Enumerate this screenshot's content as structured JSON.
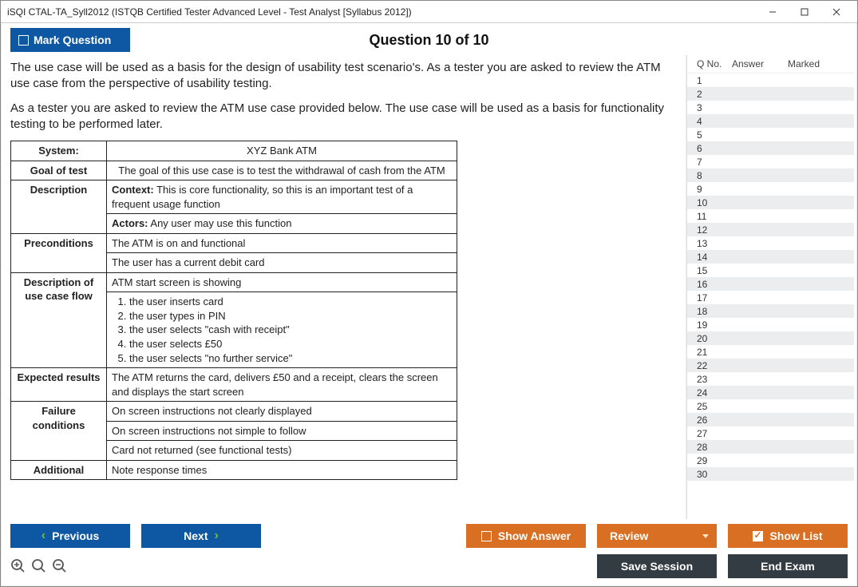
{
  "window": {
    "title": "iSQI CTAL-TA_Syll2012 (ISTQB Certified Tester Advanced Level - Test Analyst [Syllabus 2012])"
  },
  "header": {
    "mark_label": "Mark Question",
    "question_title": "Question 10 of 10"
  },
  "question": {
    "para1": "The use case will be used as a basis for the design of usability test scenario's. As a tester you are asked to review the ATM use case from the perspective of usability testing.",
    "para2": "As a tester you are asked to review the ATM use case provided below. The use case will be used as a basis for functionality testing to be performed later.",
    "table": {
      "system_lbl": "System:",
      "system_val": "XYZ Bank ATM",
      "goal_lbl": "Goal of test",
      "goal_val": "The goal of this use case is to test the withdrawal of cash from the ATM",
      "desc_lbl": "Description",
      "desc_ctx": "Context: This is core functionality, so this is an important test of a frequent usage function",
      "desc_act": "Actors: Any user may use this function",
      "precond_lbl": "Preconditions",
      "precond_1": "The ATM is on and functional",
      "precond_2": "The user has a current debit card",
      "flow_lbl": "Description of use case flow",
      "flow_head": "ATM start screen is showing",
      "flow_s1": "the user inserts card",
      "flow_s2": "the user types in PIN",
      "flow_s3": "the user selects \"cash with receipt\"",
      "flow_s4": "the user selects £50",
      "flow_s5": "the user selects \"no further service\"",
      "exp_lbl": "Expected results",
      "exp_val": "The ATM returns the card, delivers £50 and a receipt, clears the screen and displays the start screen",
      "fail_lbl": "Failure conditions",
      "fail_1": "On screen instructions not clearly displayed",
      "fail_2": "On screen instructions not simple to follow",
      "fail_3": "Card not returned (see functional tests)",
      "add_lbl": "Additional",
      "add_val": "Note response times"
    }
  },
  "nav": {
    "col_qno": "Q No.",
    "col_ans": "Answer",
    "col_mark": "Marked",
    "rows": [
      "1",
      "2",
      "3",
      "4",
      "5",
      "6",
      "7",
      "8",
      "9",
      "10",
      "11",
      "12",
      "13",
      "14",
      "15",
      "16",
      "17",
      "18",
      "19",
      "20",
      "21",
      "22",
      "23",
      "24",
      "25",
      "26",
      "27",
      "28",
      "29",
      "30"
    ]
  },
  "footer": {
    "prev": "Previous",
    "next": "Next",
    "show_answer": "Show Answer",
    "review": "Review",
    "show_list": "Show List",
    "save_session": "Save Session",
    "end_exam": "End Exam"
  }
}
